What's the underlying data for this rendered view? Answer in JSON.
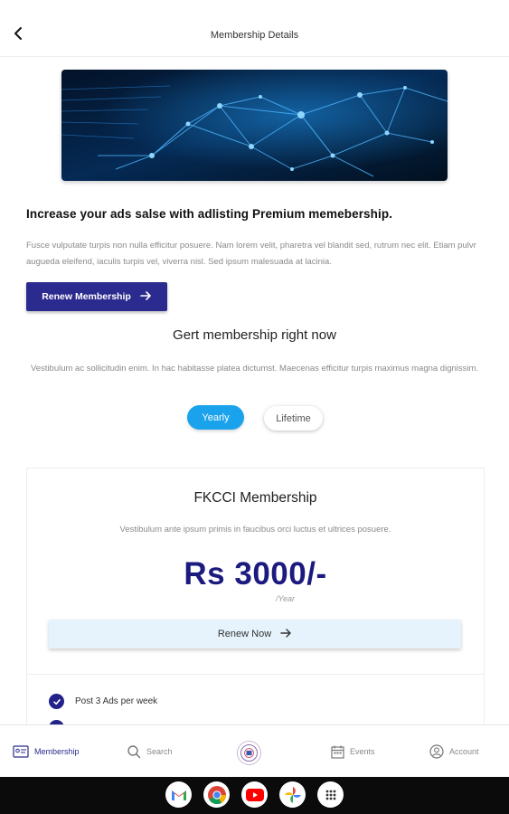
{
  "header": {
    "title": "Membership Details"
  },
  "promo": {
    "headline": "Increase your ads salse with adlisting Premium memebership.",
    "description": "Fusce vulputate turpis non nulla efficitur posuere. Nam lorem velit, pharetra vel blandit sed, rutrum nec elit. Etiam pulvr augueda eleifend, iaculis turpis vel, viverra nisl. Sed ipsum malesuada at lacinia.",
    "renew_label": "Renew Membership"
  },
  "membership_section": {
    "title": "Gert membership right now",
    "description": "Vestibulum ac sollicitudin enim. In hac habitasse platea dictumst. Maecenas efficitur turpis maximus magna dignissim.",
    "toggle": {
      "yearly": "Yearly",
      "lifetime": "Lifetime",
      "selected": "Yearly"
    }
  },
  "plan": {
    "name": "FKCCI Membership",
    "description": "Vestibulum ante ipsum primis in faucibus orci luctus et ultrices posuere.",
    "price": "Rs 3000/-",
    "period": "/Year",
    "cta_label": "Renew Now",
    "features": [
      "Post 3 Ads per week",
      ""
    ]
  },
  "bottom_nav": {
    "items": [
      {
        "label": "Membership",
        "icon": "membership-card-icon",
        "active": true
      },
      {
        "label": "Search",
        "icon": "search-icon",
        "active": false
      },
      {
        "label": "",
        "icon": "fkcci-logo-icon",
        "active": false
      },
      {
        "label": "Events",
        "icon": "calendar-icon",
        "active": false
      },
      {
        "label": "Account",
        "icon": "user-circle-icon",
        "active": false
      }
    ]
  },
  "taskbar": {
    "apps": [
      "gmail-icon",
      "chrome-icon",
      "youtube-icon",
      "photos-icon",
      "app-launcher-icon"
    ]
  },
  "colors": {
    "primary": "#2b2a8e",
    "accent": "#1aa3ec",
    "price": "#1b1a7e",
    "cta_bg": "#e6f3fc"
  }
}
